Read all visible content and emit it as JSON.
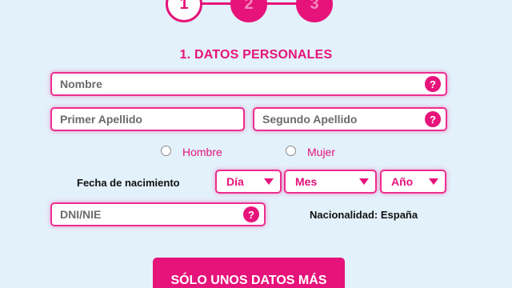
{
  "steps": [
    {
      "label": "1",
      "state": "active"
    },
    {
      "label": "2",
      "state": "inactive"
    },
    {
      "label": "3",
      "state": "inactive"
    }
  ],
  "section_title": "1. DATOS PERSONALES",
  "fields": {
    "nombre": {
      "placeholder": "Nombre",
      "value": ""
    },
    "primer_apellido": {
      "placeholder": "Primer Apellido",
      "value": ""
    },
    "segundo_apellido": {
      "placeholder": "Segundo Apellido",
      "value": ""
    },
    "dni": {
      "placeholder": "DNI/NIE",
      "value": ""
    }
  },
  "help_icon_glyph": "?",
  "gender": {
    "options": [
      {
        "label": "Hombre",
        "checked": false
      },
      {
        "label": "Mujer",
        "checked": false
      }
    ]
  },
  "birthdate": {
    "label": "Fecha de nacimiento",
    "day": "Día",
    "month": "Mes",
    "year": "Año"
  },
  "nationality": "Nacionalidad: España",
  "submit_label": "SÓLO UNOS DATOS MÁS",
  "colors": {
    "accent": "#e6137a",
    "background": "#e3f1fb",
    "field_border": "#ee2d8e"
  }
}
